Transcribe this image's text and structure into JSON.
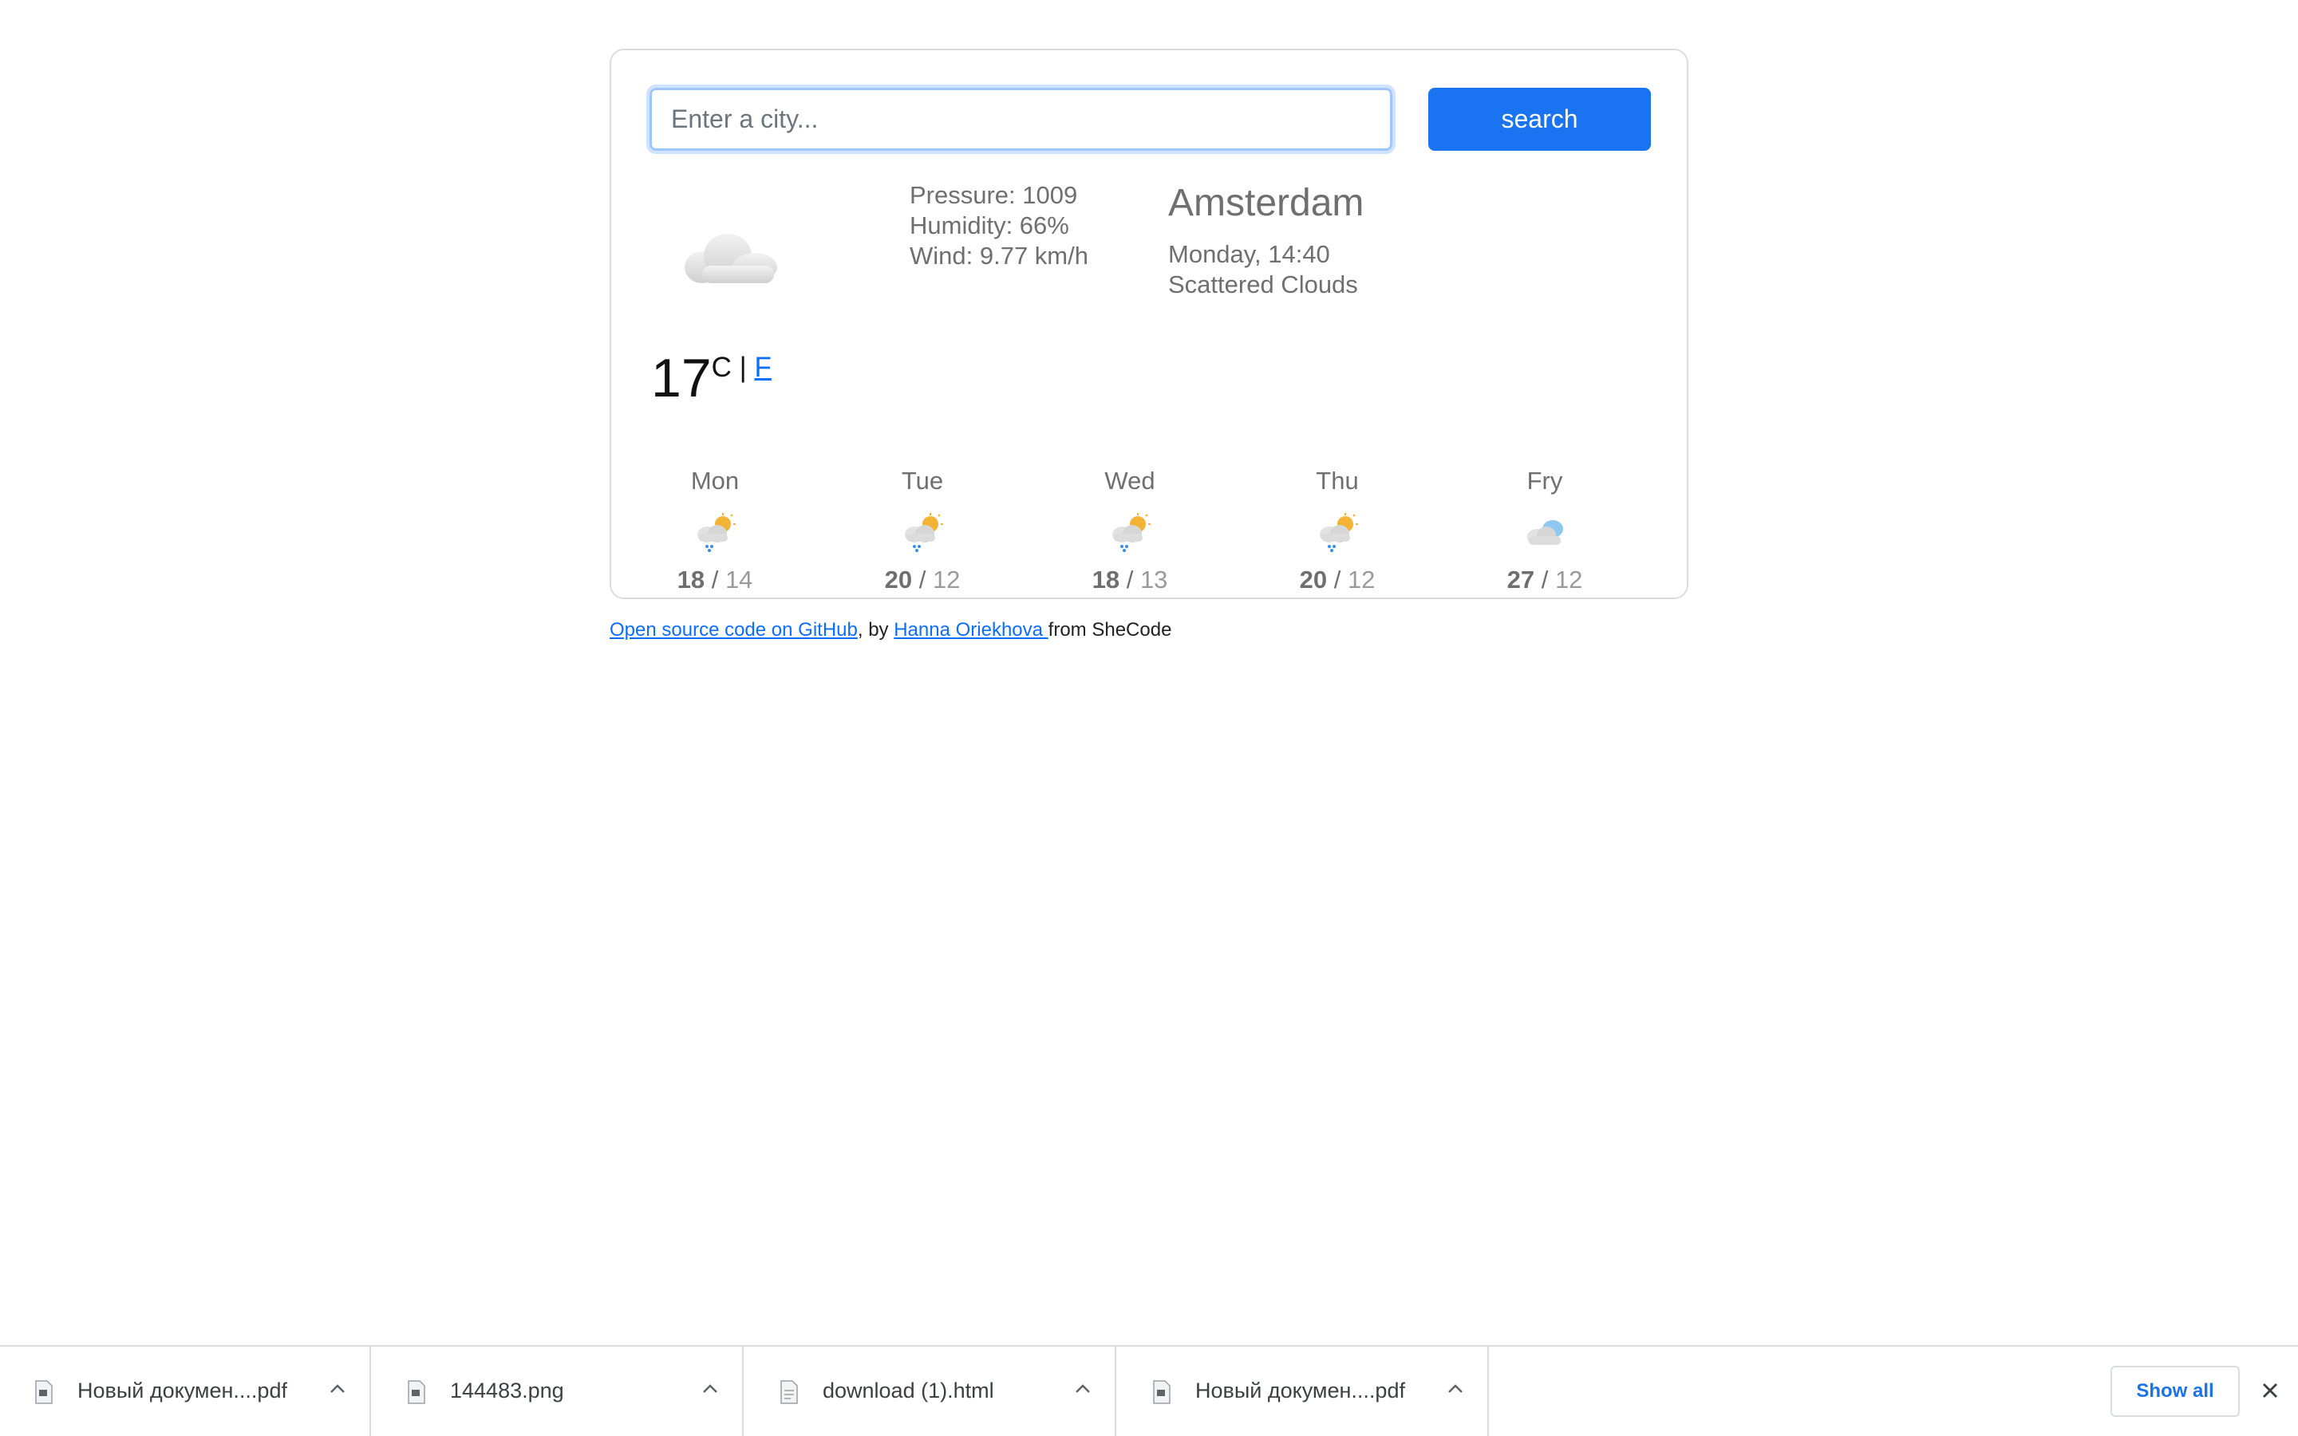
{
  "search": {
    "placeholder": "Enter a city...",
    "value": "",
    "button_label": "search"
  },
  "current": {
    "pressure": "Pressure: 1009",
    "humidity": "Humidity: 66%",
    "wind": "Wind: 9.77 km/h",
    "city": "Amsterdam",
    "datetime": "Monday, 14:40",
    "description": "Scattered Clouds",
    "icon": "cloud-icon",
    "temperature": "17",
    "unit_c": "C",
    "unit_sep": "|",
    "unit_f": "F"
  },
  "forecast": [
    {
      "day": "Mon",
      "icon": "rain-sun-icon",
      "max": "18",
      "sep": "/",
      "min": "14"
    },
    {
      "day": "Tue",
      "icon": "rain-sun-icon",
      "max": "20",
      "sep": "/",
      "min": "12"
    },
    {
      "day": "Wed",
      "icon": "rain-sun-icon",
      "max": "18",
      "sep": "/",
      "min": "13"
    },
    {
      "day": "Thu",
      "icon": "rain-sun-icon",
      "max": "20",
      "sep": "/",
      "min": "12"
    },
    {
      "day": "Fry",
      "icon": "cloud-icon",
      "max": "27",
      "sep": "/",
      "min": "12"
    }
  ],
  "footer": {
    "github_link": "Open source code on GitHub",
    "by_text": ", by ",
    "author_link": "Hanna Oriekhova ",
    "from_text": "from SheCode"
  },
  "downloads": {
    "items": [
      {
        "name": "Новый докумен....pdf",
        "icon": "pdf-file-icon"
      },
      {
        "name": "144483.png",
        "icon": "image-file-icon"
      },
      {
        "name": "download (1).html",
        "icon": "html-file-icon"
      },
      {
        "name": "Новый докумен....pdf",
        "icon": "pdf-file-icon"
      }
    ],
    "show_all_label": "Show all"
  },
  "colors": {
    "accent": "#1a73f0",
    "link": "#0d6efd",
    "muted_text": "#6f6f6f"
  }
}
